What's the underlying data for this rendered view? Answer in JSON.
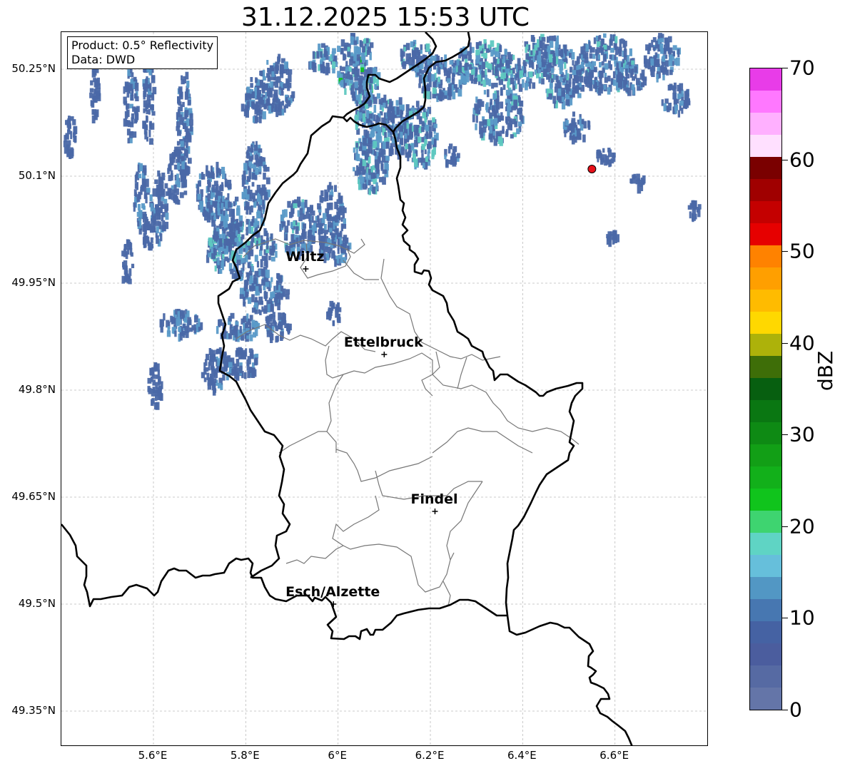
{
  "title": "31.12.2025 15:53 UTC",
  "info_box": {
    "line1": "Product: 0.5° Reflectivity",
    "line2": "Data: DWD"
  },
  "axes": {
    "lon_labels": [
      "5.6°E",
      "5.8°E",
      "6°E",
      "6.2°E",
      "6.4°E",
      "6.6°E"
    ],
    "lat_labels": [
      "50.25°N",
      "50.1°N",
      "49.95°N",
      "49.8°N",
      "49.65°N",
      "49.5°N",
      "49.35°N"
    ],
    "lon_range": [
      5.4,
      6.8
    ],
    "lat_range": [
      49.3,
      50.3
    ],
    "grid": true
  },
  "cities": [
    {
      "name": "Wiltz",
      "lon": 5.93,
      "lat": 49.97
    },
    {
      "name": "Ettelbruck",
      "lon": 6.1,
      "lat": 49.85
    },
    {
      "name": "Findel",
      "lon": 6.21,
      "lat": 49.63
    },
    {
      "name": "Esch/Alzette",
      "lon": 5.99,
      "lat": 49.5
    }
  ],
  "radar_site": {
    "lon": 6.55,
    "lat": 50.11,
    "color": "#e8101a"
  },
  "colorbar": {
    "label": "dBZ",
    "tick_labels": [
      "0",
      "10",
      "20",
      "30",
      "40",
      "50",
      "60",
      "70"
    ],
    "range": [
      0,
      70
    ],
    "colors": [
      "#6475a8",
      "#566aa3",
      "#4b5d9e",
      "#4562a3",
      "#4777b1",
      "#5297c4",
      "#66bfdb",
      "#5fd4c4",
      "#3ed470",
      "#10c41c",
      "#12b01a",
      "#129f16",
      "#0e8a14",
      "#0a7712",
      "#075f10",
      "#3e6e08",
      "#adb20a",
      "#ffd800",
      "#ffbb00",
      "#ff9f00",
      "#ff8200",
      "#e60000",
      "#c40000",
      "#a00000",
      "#7a0000",
      "#ffe0ff",
      "#ffb0ff",
      "#ff78ff",
      "#e83ce8"
    ]
  },
  "echo_colors": {
    "light": "#4a68a6",
    "mid": "#5a9ac8",
    "teal": "#5ec8c0",
    "green": "#12c020"
  }
}
